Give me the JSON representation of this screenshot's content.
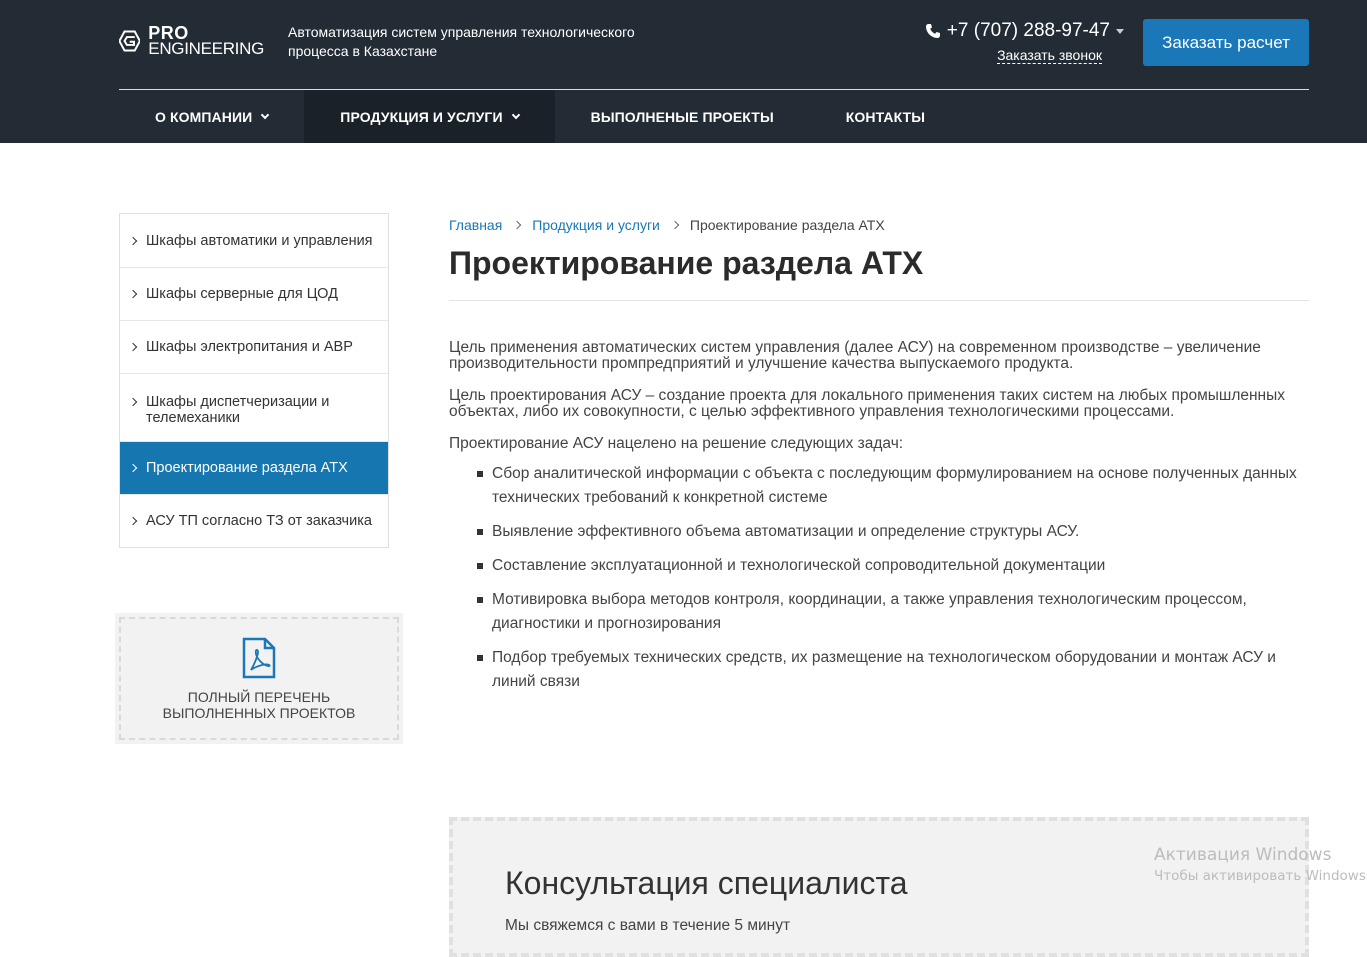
{
  "header": {
    "logo": {
      "line1": "PRO",
      "line2": "ENGINEERING"
    },
    "tagline": "Автоматизация систем управления технологического процесса в Казахстане",
    "phone": "+7 (707) 288-97-47",
    "callback_label": "Заказать звонок",
    "order_button": "Заказать расчет"
  },
  "nav": {
    "items": [
      {
        "label": "О КОМПАНИИ",
        "dropdown": true,
        "active": false
      },
      {
        "label": "ПРОДУКЦИЯ И УСЛУГИ",
        "dropdown": true,
        "active": true
      },
      {
        "label": "ВЫПОЛНЕНЫЕ ПРОЕКТЫ",
        "dropdown": false,
        "active": false
      },
      {
        "label": "КОНТАКТЫ",
        "dropdown": false,
        "active": false
      }
    ]
  },
  "sidebar": {
    "items": [
      {
        "label": "Шкафы автоматики и управления"
      },
      {
        "label": "Шкафы серверные для ЦОД"
      },
      {
        "label": "Шкафы электропитания и АВР"
      },
      {
        "label": "Шкафы диспетчеризации и телемеханики"
      },
      {
        "label": "Проектирование раздела АТХ"
      },
      {
        "label": "АСУ ТП согласно ТЗ от заказчика"
      }
    ],
    "pdf_box": {
      "line1": "ПОЛНЫЙ ПЕРЕЧЕНЬ",
      "line2": "ВЫПОЛНЕННЫХ ПРОЕКТОВ"
    }
  },
  "breadcrumb": {
    "home": "Главная",
    "section": "Продукция и услуги",
    "current": "Проектирование раздела АТХ"
  },
  "page_title": "Проектирование раздела АТХ",
  "content": {
    "p1": "Цель применения автоматических систем управления (далее АСУ) на современном производстве – увеличение производительности промпредприятий и улучшение качества выпускаемого продукта.",
    "p2": "Цель проектирования АСУ – создание проекта для локального применения таких систем на любых промышленных объектах, либо их совокупности, с целью эффективного управления технологическими процессами.",
    "p3": "Проектирование АСУ нацелено на решение следующих задач:",
    "list": [
      "Сбор аналитической информации с объекта с последующим формулированием на основе полученных данных технических требований к конкретной системе",
      "Выявление эффективного объема автоматизации и определение структуры АСУ.",
      "Составление эксплуатационной и технологической сопроводительной документации",
      "Мотивировка выбора методов контроля, координации, а также управления технологическим процессом, диагностики и прогнозирования",
      "Подбор требуемых технических средств, их размещение на технологическом оборудовании и монтаж АСУ и линий связи"
    ]
  },
  "consult": {
    "title": "Консультация специалиста",
    "subtitle": "Мы свяжемся с вами в течение 5 минут"
  },
  "windows_activation": {
    "title": "Активация Windows",
    "subtitle": "Чтобы активировать Windows, п"
  },
  "colors": {
    "header_bg": "#232b35",
    "accent": "#1a77b8",
    "active_side": "#1576b0"
  }
}
